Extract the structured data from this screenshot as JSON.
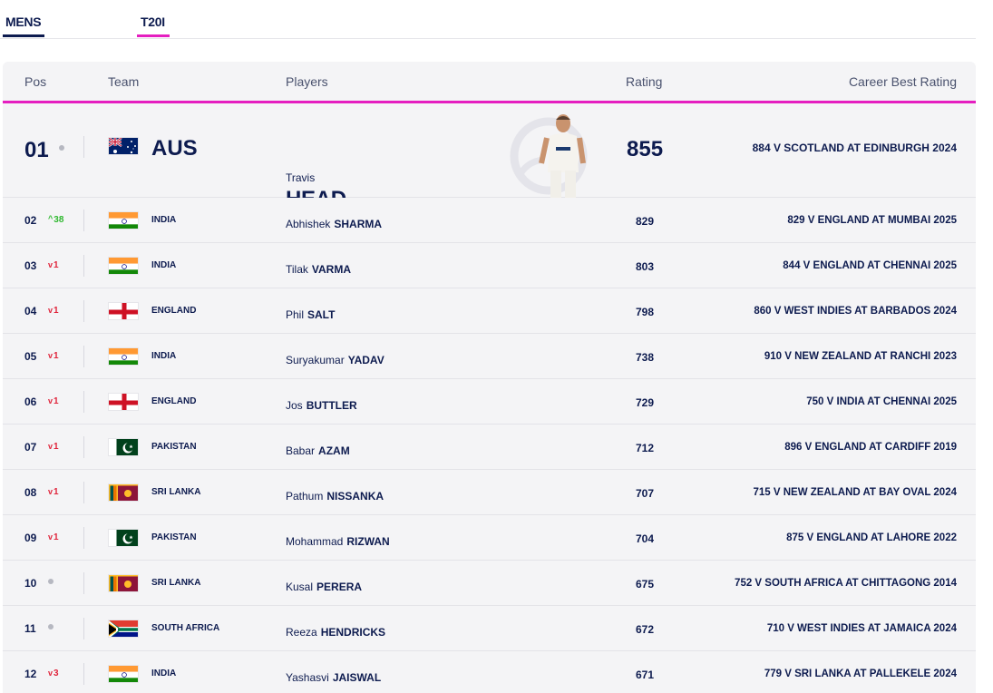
{
  "tabs": {
    "gender": "MENS",
    "format": "T20I"
  },
  "header": {
    "pos": "Pos",
    "team": "Team",
    "players": "Players",
    "rating": "Rating",
    "best": "Career Best Rating"
  },
  "top": {
    "pos": "01",
    "movement": {
      "dir": "same",
      "amount": ""
    },
    "flag": "aus-flag",
    "team": "AUS",
    "first": "Travis",
    "last": "HEAD",
    "rating": "855",
    "best": "884 V SCOTLAND AT EDINBURGH 2024"
  },
  "rows": [
    {
      "pos": "02",
      "movement": {
        "dir": "up",
        "amount": "38"
      },
      "flag": "india-flag",
      "team": "INDIA",
      "first": "Abhishek",
      "last": "SHARMA",
      "rating": "829",
      "best": "829 V ENGLAND AT MUMBAI 2025"
    },
    {
      "pos": "03",
      "movement": {
        "dir": "down",
        "amount": "1"
      },
      "flag": "india-flag",
      "team": "INDIA",
      "first": "Tilak",
      "last": "VARMA",
      "rating": "803",
      "best": "844 V ENGLAND AT CHENNAI 2025"
    },
    {
      "pos": "04",
      "movement": {
        "dir": "down",
        "amount": "1"
      },
      "flag": "england-flag",
      "team": "ENGLAND",
      "first": "Phil",
      "last": "SALT",
      "rating": "798",
      "best": "860 V WEST INDIES AT BARBADOS 2024"
    },
    {
      "pos": "05",
      "movement": {
        "dir": "down",
        "amount": "1"
      },
      "flag": "india-flag",
      "team": "INDIA",
      "first": "Suryakumar",
      "last": "YADAV",
      "rating": "738",
      "best": "910 V NEW ZEALAND AT RANCHI 2023"
    },
    {
      "pos": "06",
      "movement": {
        "dir": "down",
        "amount": "1"
      },
      "flag": "england-flag",
      "team": "ENGLAND",
      "first": "Jos",
      "last": "BUTTLER",
      "rating": "729",
      "best": "750 V INDIA AT CHENNAI 2025"
    },
    {
      "pos": "07",
      "movement": {
        "dir": "down",
        "amount": "1"
      },
      "flag": "pakistan-flag",
      "team": "PAKISTAN",
      "first": "Babar",
      "last": "AZAM",
      "rating": "712",
      "best": "896 V ENGLAND AT CARDIFF 2019"
    },
    {
      "pos": "08",
      "movement": {
        "dir": "down",
        "amount": "1"
      },
      "flag": "sri-lanka-flag",
      "team": "SRI LANKA",
      "first": "Pathum",
      "last": "NISSANKA",
      "rating": "707",
      "best": "715 V NEW ZEALAND AT BAY OVAL 2024"
    },
    {
      "pos": "09",
      "movement": {
        "dir": "down",
        "amount": "1"
      },
      "flag": "pakistan-flag",
      "team": "PAKISTAN",
      "first": "Mohammad",
      "last": "RIZWAN",
      "rating": "704",
      "best": "875 V ENGLAND AT LAHORE 2022"
    },
    {
      "pos": "10",
      "movement": {
        "dir": "same",
        "amount": ""
      },
      "flag": "sri-lanka-flag",
      "team": "SRI LANKA",
      "first": "Kusal",
      "last": "PERERA",
      "rating": "675",
      "best": "752 V SOUTH AFRICA AT CHITTAGONG 2014"
    },
    {
      "pos": "11",
      "movement": {
        "dir": "same",
        "amount": ""
      },
      "flag": "south-africa-flag",
      "team": "SOUTH AFRICA",
      "first": "Reeza",
      "last": "HENDRICKS",
      "rating": "672",
      "best": "710 V WEST INDIES AT JAMAICA 2024"
    },
    {
      "pos": "12",
      "movement": {
        "dir": "down",
        "amount": "3"
      },
      "flag": "india-flag",
      "team": "INDIA",
      "first": "Yashasvi",
      "last": "JAISWAL",
      "rating": "671",
      "best": "779 V SRI LANKA AT PALLEKELE 2024"
    }
  ],
  "colors": {
    "navy": "#0d1b4f",
    "accent": "#e51ec0",
    "up": "#2eb82e",
    "down": "#e0243b",
    "row_bg": "#f4f4f6"
  }
}
